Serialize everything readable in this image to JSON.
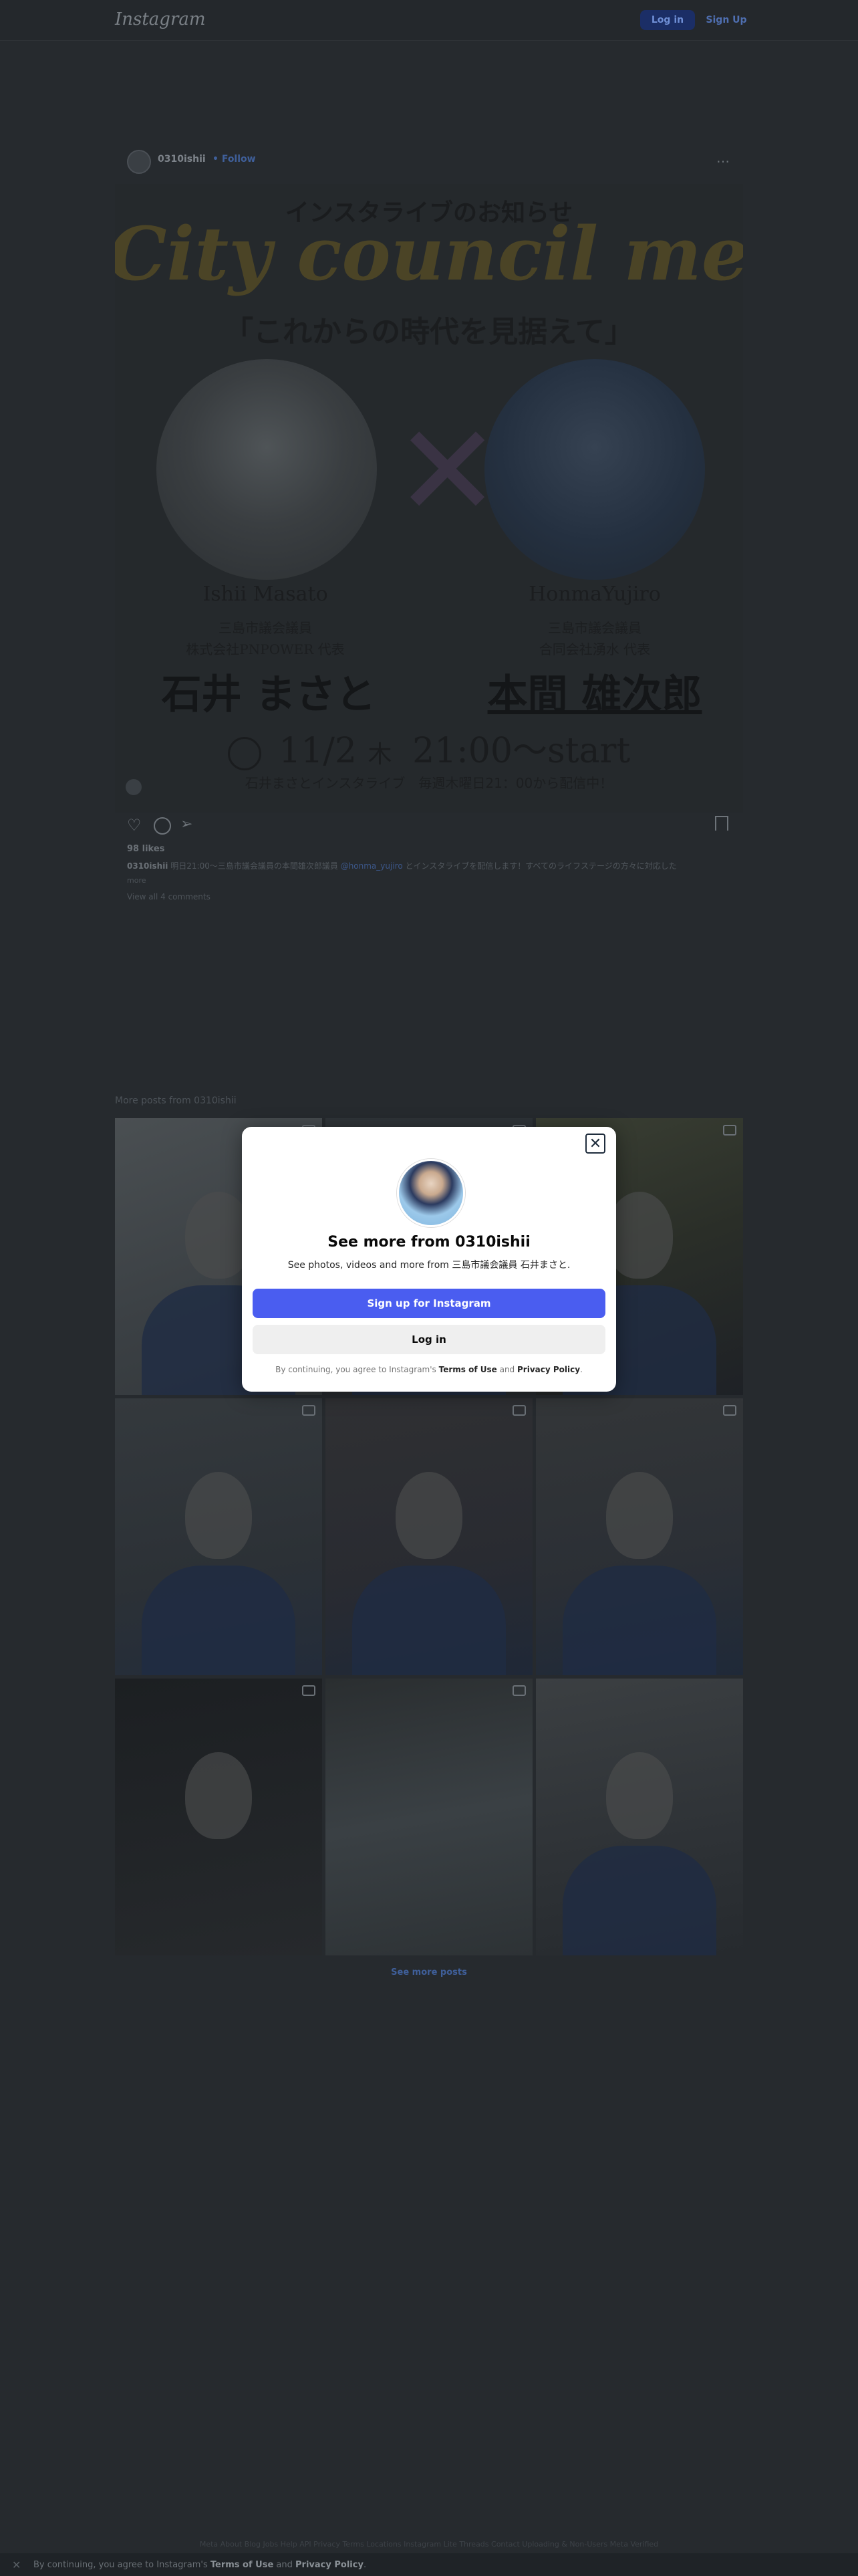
{
  "header": {
    "logo": "Instagram",
    "login_label": "Log in",
    "signup_label": "Sign Up"
  },
  "post": {
    "username": "0310ishii",
    "follow_label": "• Follow",
    "more": "…",
    "image": {
      "title": "インスタライブのお知らせ",
      "script": "City council member",
      "subtitle": "「これからの時代を見据えて」",
      "left_name_en": "Ishii Masato",
      "left_role_1": "三島市議会議員",
      "left_role_2": "株式会社PNPOWER 代表",
      "left_name_jp": "石井 まさと",
      "right_name_en": "HonmaYujiro",
      "right_role_1": "三島市議会議員",
      "right_role_2": "合同会社湧水 代表",
      "right_name_jp": "本間 雄次郎",
      "date_text": "11/2",
      "weekday": "木",
      "time_text": "21:00～start",
      "footer_text": "石井まさとインスタライブ　毎週木曜日21：00から配信中！"
    },
    "likes": "98 likes",
    "caption_user": "0310ishii",
    "caption_text": "明日21:00〜三島市議会議員の本間雄次郎議員",
    "caption_tag": "@honma_yujiro",
    "caption_rest": "とインスタライブを配信します！すべてのライフステージの方々に対応した",
    "caption_more": "more",
    "comments_link": "View all 4 comments"
  },
  "more_posts": {
    "heading": "More posts from 0310ishii",
    "see_more": "See more posts"
  },
  "modal": {
    "title": "See more from 0310ishii",
    "subtitle": "See photos, videos and more from 三島市議会議員 石井まさと.",
    "signup_label": "Sign up for Instagram",
    "login_label": "Log in",
    "terms_prefix": "By continuing, you agree to Instagram's",
    "terms_link": "Terms of Use",
    "terms_and": "and",
    "privacy_link": "Privacy Policy",
    "terms_suffix": ".",
    "close_icon": "close-icon"
  },
  "footer": {
    "links": "Meta  About  Blog  Jobs  Help  API  Privacy  Terms  Locations  Instagram Lite  Threads  Contact Uploading & Non-Users  Meta Verified",
    "cookie_prefix": "By continuing, you agree to Instagram's",
    "cookie_terms": "Terms of Use",
    "cookie_and": "and",
    "cookie_privacy": "Privacy Policy",
    "cookie_suffix": "."
  },
  "colors": {
    "accent": "#4a5df0",
    "overlay_bg": "#262a2e",
    "modal_bg": "#ffffff"
  }
}
